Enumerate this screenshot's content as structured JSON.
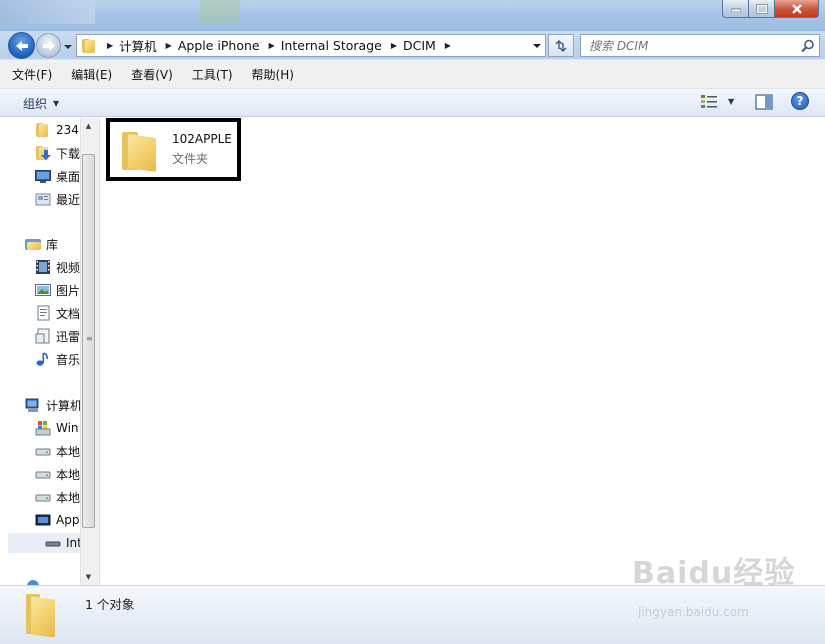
{
  "window": {
    "minimize_icon": "minimize-icon",
    "maximize_icon": "maximize-icon",
    "close_icon": "close-icon"
  },
  "address_bar": {
    "breadcrumbs": [
      "计算机",
      "Apple iPhone",
      "Internal Storage",
      "DCIM"
    ],
    "search_placeholder": "搜索 DCIM"
  },
  "menu": {
    "items": [
      "文件(F)",
      "编辑(E)",
      "查看(V)",
      "工具(T)",
      "帮助(H)"
    ]
  },
  "toolbar": {
    "organize_label": "组织",
    "help_label": "?"
  },
  "nav_pane": {
    "favorites": [
      "234",
      "下载",
      "桌面",
      "最近"
    ],
    "library_header": "库",
    "libraries": [
      "视频",
      "图片",
      "文档",
      "迅雷",
      "音乐"
    ],
    "computer_header": "计算机",
    "computer": [
      "Win",
      "本地",
      "本地",
      "本地",
      "App"
    ],
    "selected": "Int"
  },
  "content": {
    "items": [
      {
        "name": "102APPLE",
        "type": "文件夹"
      }
    ]
  },
  "details": {
    "status": "1 个对象"
  },
  "watermark": {
    "text": "Baidu经验",
    "sub": "jingyan.baidu.com"
  }
}
